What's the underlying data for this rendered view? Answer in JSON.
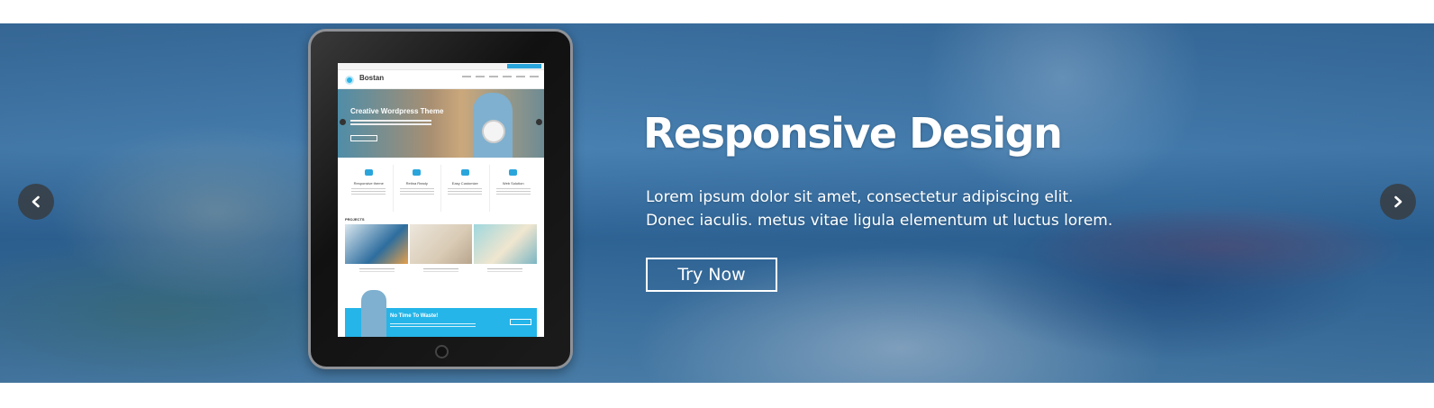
{
  "slide": {
    "headline": "Responsive Design",
    "description_line1": "Lorem ipsum dolor sit amet, consectetur adipiscing elit.",
    "description_line2": "Donec iaculis. metus vitae ligula elementum ut luctus lorem.",
    "cta_label": "Try Now"
  },
  "controls": {
    "prev_icon": "chevron-left-icon",
    "next_icon": "chevron-right-icon"
  },
  "mockup": {
    "site_name": "Bostan",
    "hero_title": "Creative Wordpress Theme",
    "features": [
      "Responsive theme",
      "Retina Ready",
      "Easy Customize",
      "Web Solution"
    ],
    "projects_label": "PROJECTS",
    "cta_title": "No Time To Waste!"
  },
  "colors": {
    "accent": "#25b5e8",
    "text": "#ffffff",
    "arrow_bg": "#373c41"
  }
}
